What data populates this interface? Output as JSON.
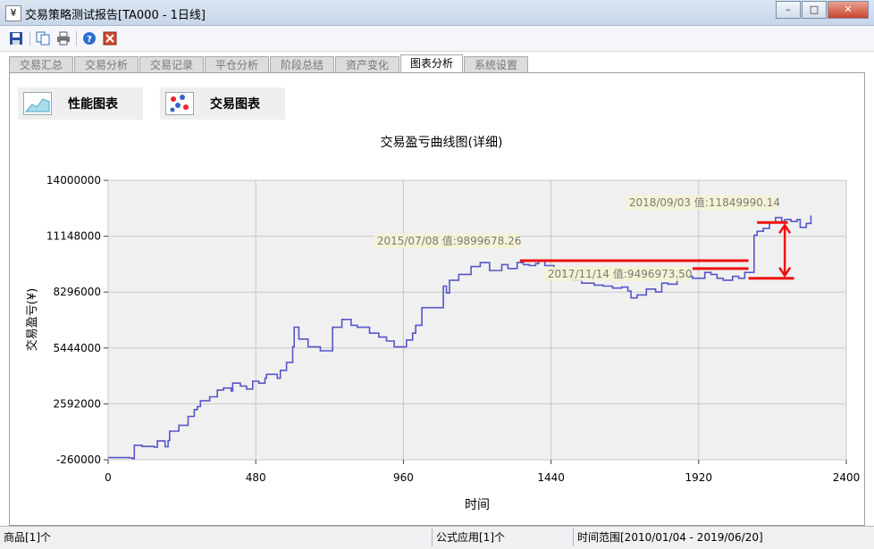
{
  "window": {
    "title": "交易策略测试报告[TA000 - 1日线]",
    "app_icon_glyph": "¥"
  },
  "tabs": [
    {
      "label": "交易汇总",
      "active": false
    },
    {
      "label": "交易分析",
      "active": false
    },
    {
      "label": "交易记录",
      "active": false
    },
    {
      "label": "平仓分析",
      "active": false
    },
    {
      "label": "阶段总结",
      "active": false
    },
    {
      "label": "资产变化",
      "active": false
    },
    {
      "label": "图表分析",
      "active": true
    },
    {
      "label": "系统设置",
      "active": false
    }
  ],
  "chart_buttons": {
    "performance": "性能图表",
    "trade": "交易图表"
  },
  "status": {
    "product": "商品[1]个",
    "formula": "公式应用[1]个",
    "range": "时间范围[2010/01/04 - 2019/06/20]"
  },
  "colors": {
    "line": "#5656c8",
    "annotation": "#ee1111",
    "plot_bg": "#f0f0f0",
    "label_bg": "#f5f3d2"
  },
  "chart_data": {
    "type": "line",
    "title": "交易盈亏曲线图(详细)",
    "xlabel": "时间",
    "ylabel": "交易盈亏(¥)",
    "xlim": [
      0,
      2400
    ],
    "ylim": [
      -260000,
      14000000
    ],
    "xticks": [
      0,
      480,
      960,
      1440,
      1920,
      2400
    ],
    "yticks": [
      "-260000",
      "2592000",
      "5444000",
      "8296000",
      "11148000",
      "14000000"
    ],
    "grid": true,
    "series": [
      {
        "x": [
          0,
          70,
          80,
          85,
          110,
          150,
          160,
          185,
          195,
          200,
          230,
          260,
          280,
          290,
          300,
          330,
          355,
          375,
          400,
          405,
          430,
          450,
          470,
          490,
          510,
          515,
          550,
          560,
          580,
          600,
          605,
          620,
          650,
          690,
          730,
          760,
          790,
          810,
          850,
          880,
          905,
          930,
          960,
          970,
          990,
          1000,
          1020,
          1060,
          1090,
          1100,
          1110,
          1140,
          1180,
          1210,
          1240,
          1280,
          1300,
          1330,
          1350,
          1370,
          1390,
          1400,
          1420,
          1450,
          1480,
          1510,
          1540,
          1580,
          1610,
          1640,
          1670,
          1690,
          1700,
          1720,
          1750,
          1780,
          1800,
          1820,
          1850,
          1900,
          1940,
          1960,
          1980,
          2000,
          2030,
          2050,
          2070,
          2080,
          2100,
          2110,
          2130,
          2150,
          2170,
          2190,
          2200,
          2220,
          2240,
          2250,
          2270,
          2285
        ],
        "y": [
          -150000,
          -170000,
          -200000,
          480000,
          420000,
          380000,
          700000,
          400000,
          720000,
          1200000,
          1500000,
          1950000,
          2300000,
          2450000,
          2750000,
          2950000,
          3300000,
          3400000,
          3250000,
          3650000,
          3500000,
          3350000,
          3750000,
          3650000,
          3900000,
          4100000,
          3900000,
          4300000,
          4700000,
          5500000,
          6500000,
          5900000,
          5500000,
          5300000,
          6500000,
          6900000,
          6600000,
          6500000,
          6200000,
          6000000,
          5800000,
          5500000,
          5500000,
          5850000,
          6200000,
          6600000,
          7500000,
          7500000,
          8600000,
          8250000,
          8900000,
          9200000,
          9600000,
          9800000,
          9400000,
          9700000,
          9500000,
          9800000,
          9700000,
          9650000,
          9750000,
          9900000,
          9650000,
          9400000,
          9100000,
          8900000,
          8750000,
          8650000,
          8600000,
          8500000,
          8550000,
          8350000,
          8000000,
          8150000,
          8450000,
          8300000,
          8750000,
          8700000,
          9100000,
          9000000,
          9300000,
          9200000,
          9000000,
          8900000,
          9100000,
          9000000,
          9300000,
          9300000,
          11200000,
          11400000,
          11550000,
          11850000,
          12100000,
          11900000,
          12000000,
          11900000,
          12000000,
          11600000,
          11800000,
          12200000
        ]
      }
    ],
    "annotations": [
      {
        "label": "2015/07/08 值:9899678.26",
        "x": 1339,
        "y": 9899678.26
      },
      {
        "label": "2017/11/14 值:9496973.50",
        "x": 1900,
        "y": 9496973.5
      },
      {
        "label": "2018/09/03 值:11849990.14",
        "x": 2170,
        "y": 11849990.14
      }
    ]
  }
}
